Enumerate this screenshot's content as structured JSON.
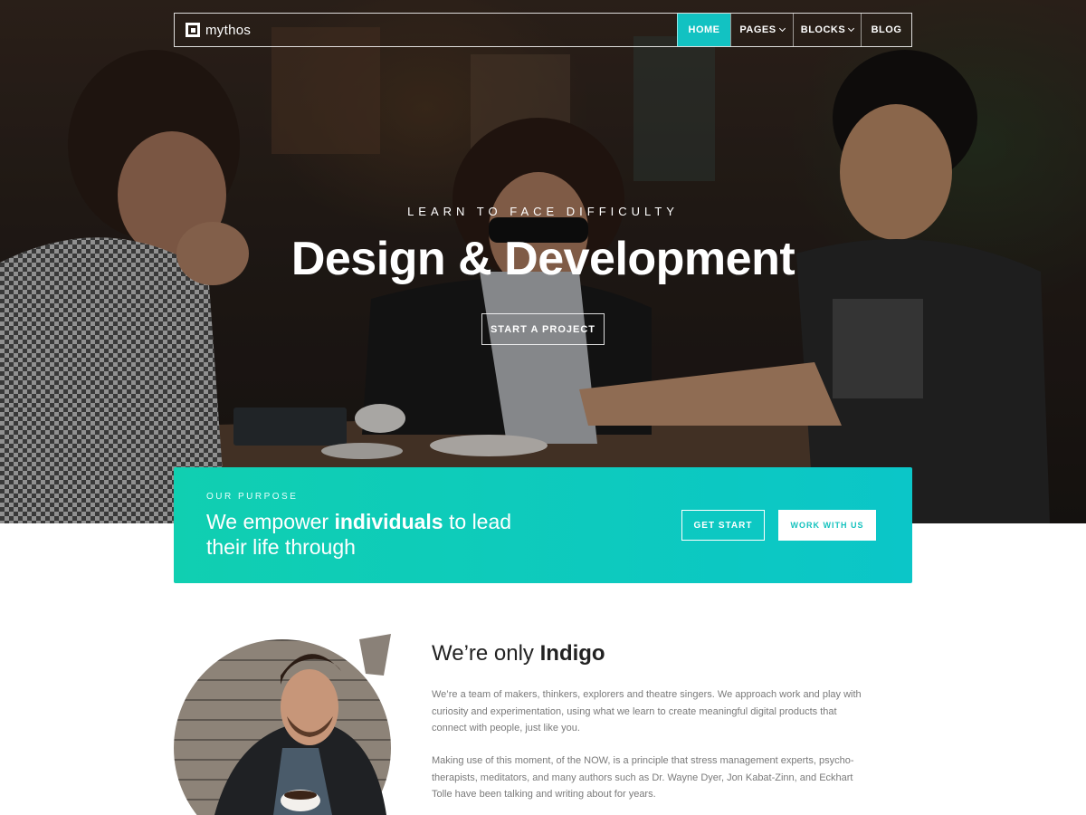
{
  "nav": {
    "brand": "mythos",
    "items": [
      {
        "label": "HOME",
        "active": true,
        "dropdown": false
      },
      {
        "label": "PAGES",
        "active": false,
        "dropdown": true
      },
      {
        "label": "BLOCKS",
        "active": false,
        "dropdown": true
      },
      {
        "label": "BLOG",
        "active": false,
        "dropdown": false
      }
    ]
  },
  "hero": {
    "eyebrow": "LEARN TO FACE DIFFICULTY",
    "title": "Design & Development",
    "cta": "START A PROJECT"
  },
  "purpose": {
    "label": "OUR PURPOSE",
    "text_before": "We empower ",
    "text_bold": "individuals",
    "text_after": " to lead their life through",
    "button_outline": "GET START",
    "button_solid": "WORK WITH US"
  },
  "about": {
    "title_prefix": "We’re only ",
    "title_bold": "Indigo",
    "paragraph1": "We’re a team of makers, thinkers, explorers and theatre singers. We approach work and play with curiosity and experimentation, using what we learn to create meaningful digital products that connect with people, just like you.",
    "paragraph2": "Making use of this moment, of the NOW, is a principle that stress management experts, psycho-therapists, meditators, and many authors such as Dr. Wayne Dyer, Jon Kabat-Zinn, and Eckhart Tolle have been talking and writing about for years."
  },
  "colors": {
    "accent": "#12c2c2",
    "band_start": "#10cfb1",
    "band_end": "#0bc6c8"
  },
  "icons": {
    "brand": "brand-logo-icon",
    "dropdown": "chevron-down-icon"
  }
}
